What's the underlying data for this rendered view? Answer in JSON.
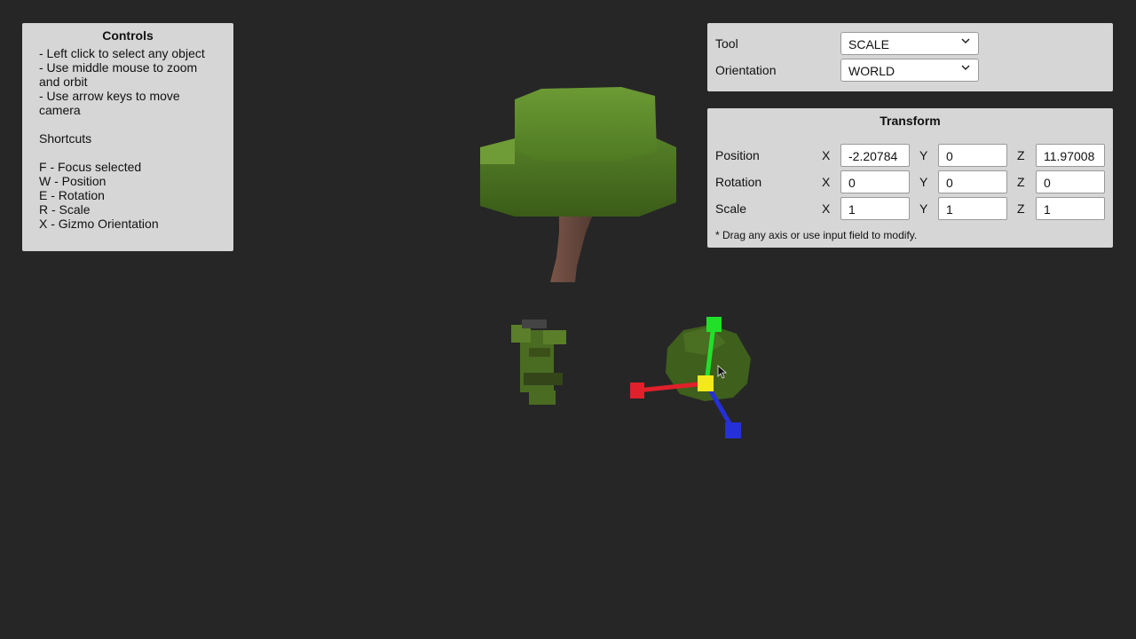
{
  "controls": {
    "title": "Controls",
    "lines": [
      "- Left click to select any object",
      "- Use middle mouse to zoom",
      "and orbit",
      "- Use arrow keys to move",
      "camera"
    ],
    "shortcuts_title": "Shortcuts",
    "shortcuts": [
      "F - Focus selected",
      "W - Position",
      "E - Rotation",
      "R - Scale",
      "X - Gizmo Orientation"
    ]
  },
  "tool_panel": {
    "tool_label": "Tool",
    "tool_value": "SCALE",
    "orientation_label": "Orientation",
    "orientation_value": "WORLD"
  },
  "transform": {
    "title": "Transform",
    "rows": [
      {
        "label": "Position",
        "x": "-2.20784",
        "y": "0",
        "z": "11.97008"
      },
      {
        "label": "Rotation",
        "x": "0",
        "y": "0",
        "z": "0"
      },
      {
        "label": "Scale",
        "x": "1",
        "y": "1",
        "z": "1"
      }
    ],
    "axis_x": "X",
    "axis_y": "Y",
    "axis_z": "Z",
    "note": "* Drag any axis or use input field to modify."
  },
  "colors": {
    "background": "#262626",
    "panel": "#d6d6d6",
    "gizmo_x": "#e0202a",
    "gizmo_y": "#22e02a",
    "gizmo_z": "#2430d8",
    "gizmo_center": "#f2e81a"
  }
}
